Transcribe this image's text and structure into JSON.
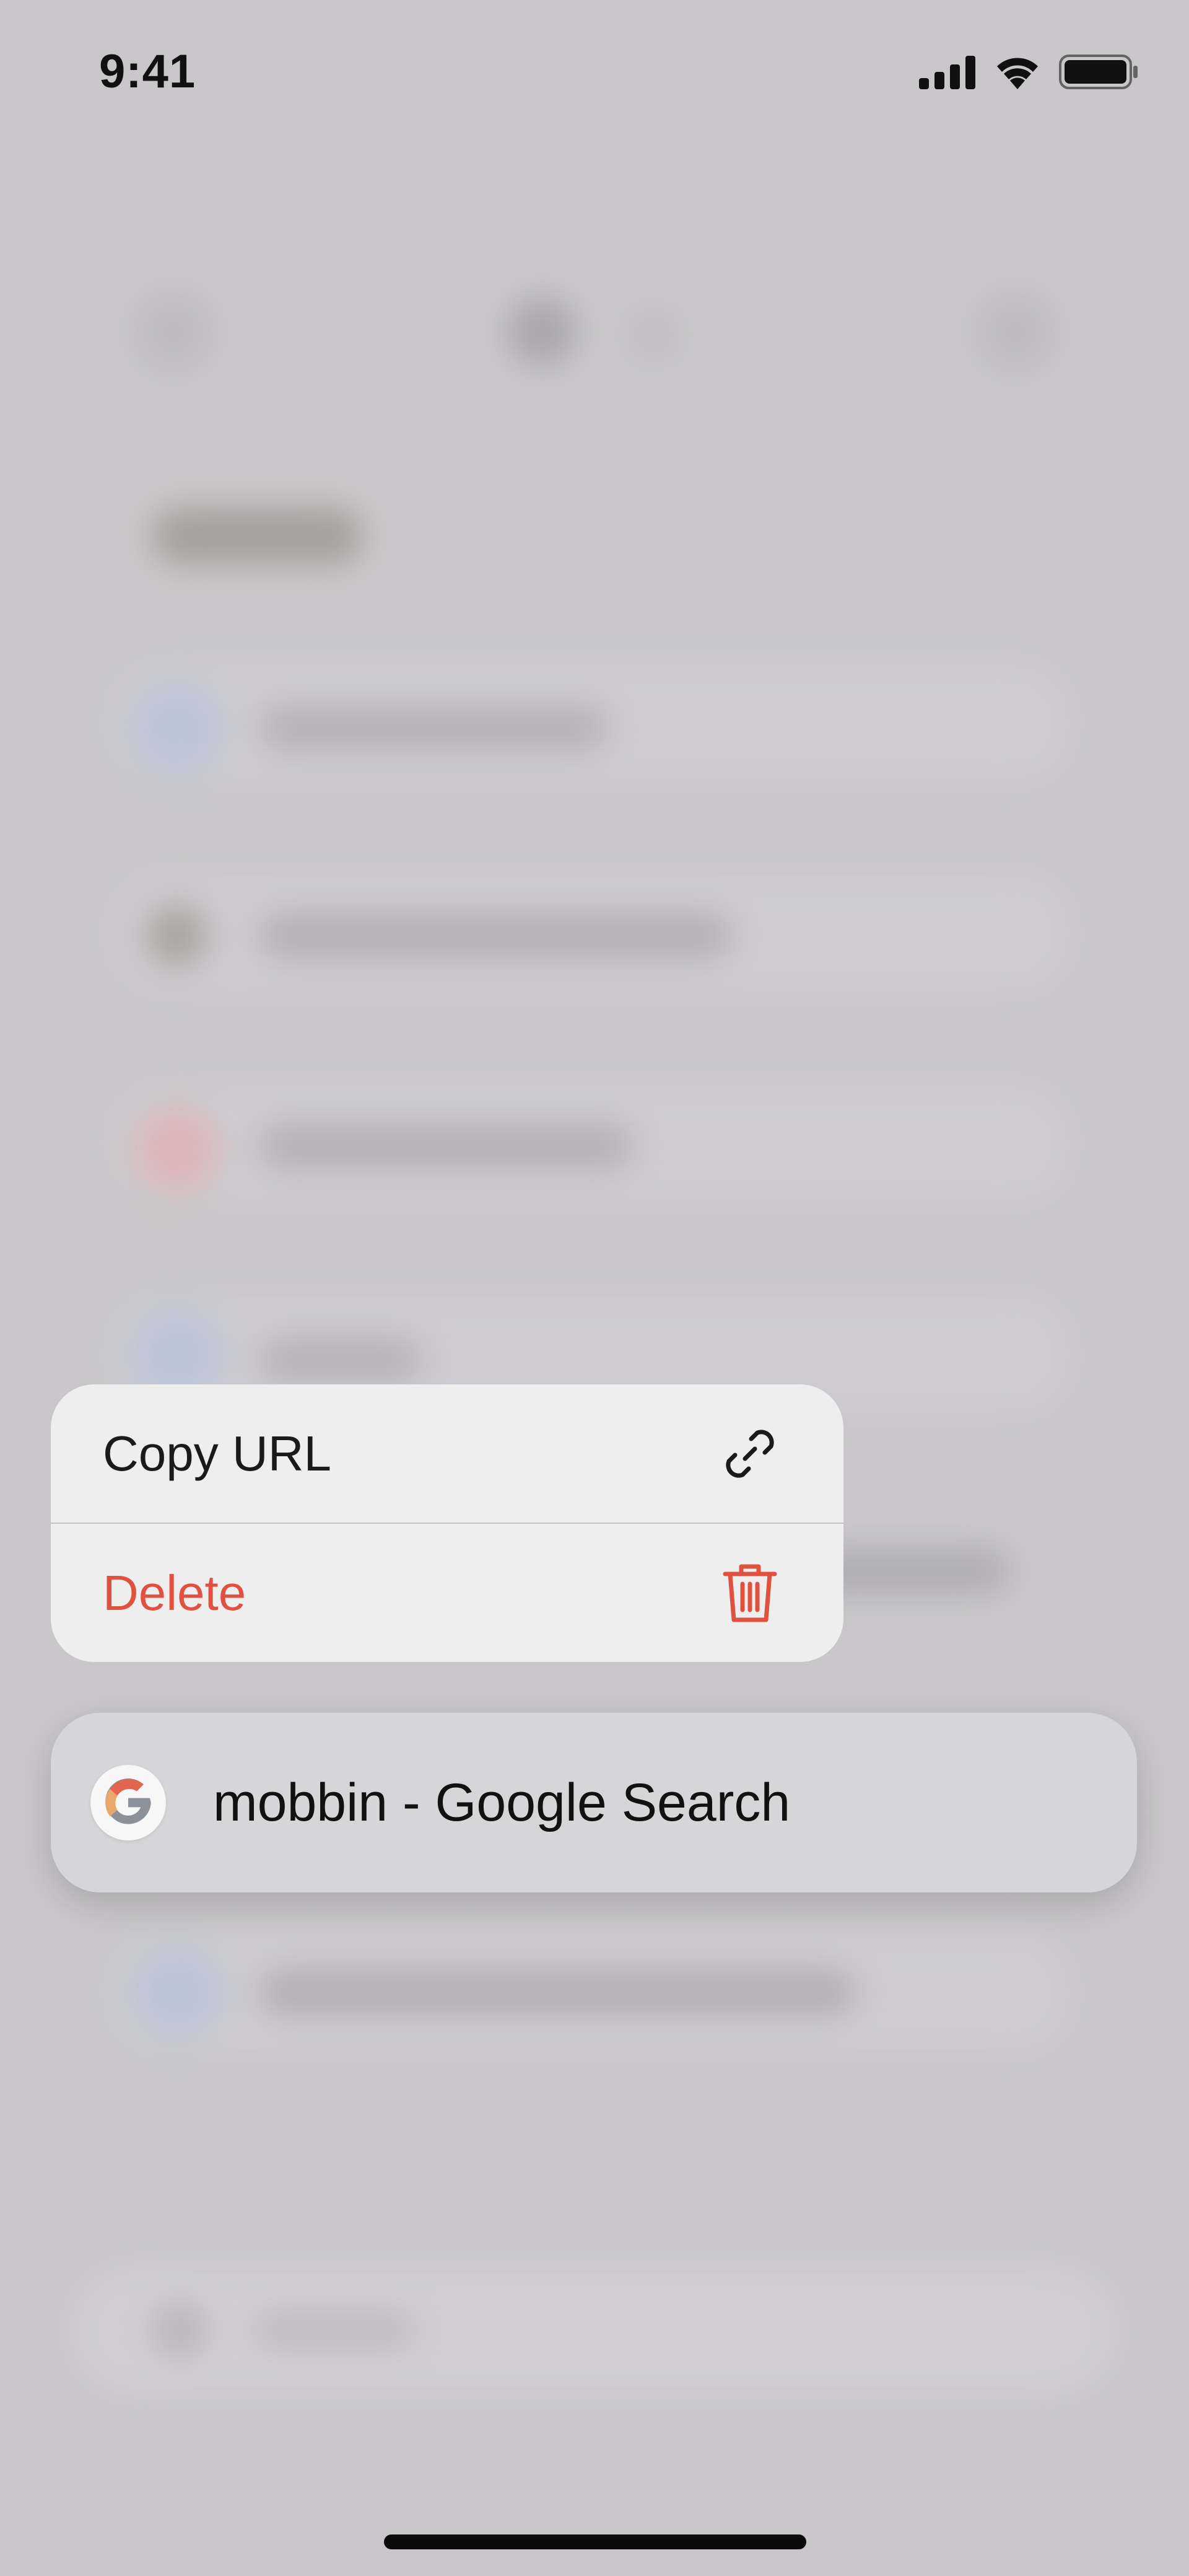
{
  "status_bar": {
    "time": "9:41",
    "icons": [
      "cellular-signal-icon",
      "wifi-icon",
      "battery-icon"
    ]
  },
  "context_menu": {
    "items": [
      {
        "label": "Copy URL",
        "icon": "link-icon",
        "destructive": false
      },
      {
        "label": "Delete",
        "icon": "trash-icon",
        "destructive": true
      }
    ]
  },
  "focused_item": {
    "title": "mobbin - Google Search",
    "favicon": "google-g-icon"
  },
  "colors": {
    "background": "#c9c7c9",
    "menu_background": "#efeeef",
    "destructive": "#e0523f",
    "row_background": "#d6d5d7"
  }
}
